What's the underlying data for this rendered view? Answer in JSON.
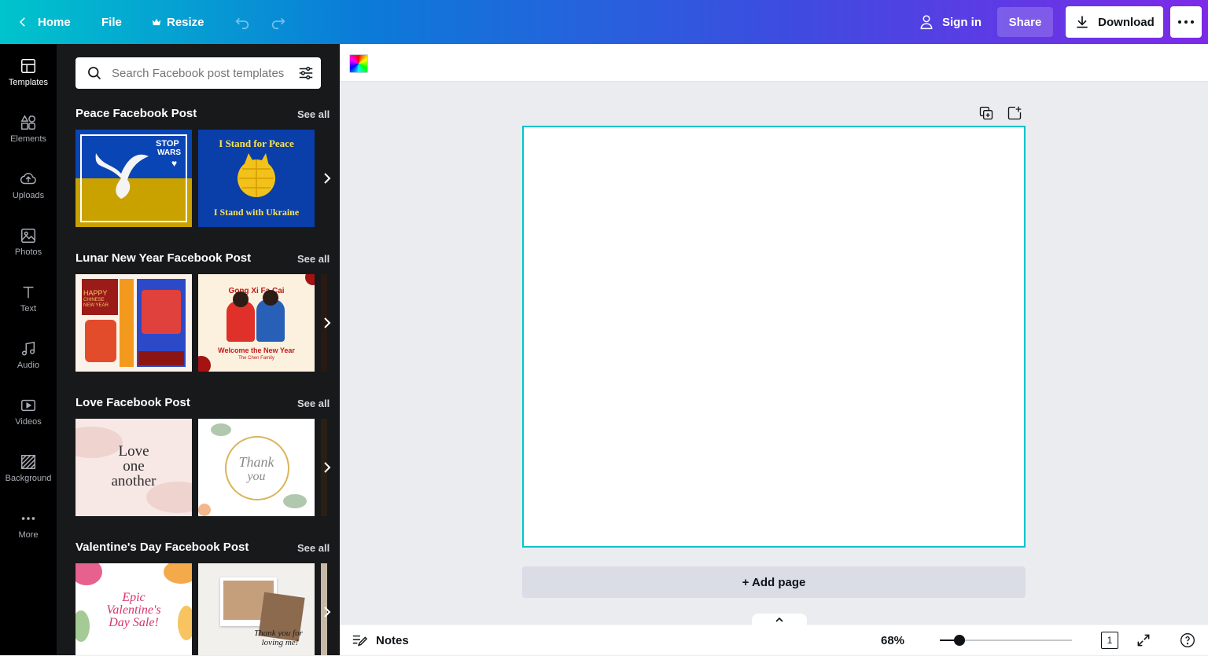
{
  "topbar": {
    "home_label": "Home",
    "file_label": "File",
    "resize_label": "Resize",
    "sign_in_label": "Sign in",
    "share_label": "Share",
    "download_label": "Download"
  },
  "rail": {
    "items": [
      {
        "label": "Templates",
        "icon": "templates-icon",
        "active": true
      },
      {
        "label": "Elements",
        "icon": "elements-icon"
      },
      {
        "label": "Uploads",
        "icon": "upload-cloud-icon"
      },
      {
        "label": "Photos",
        "icon": "image-icon"
      },
      {
        "label": "Text",
        "icon": "text-icon"
      },
      {
        "label": "Audio",
        "icon": "music-note-icon"
      },
      {
        "label": "Videos",
        "icon": "video-icon"
      },
      {
        "label": "Background",
        "icon": "background-pattern-icon"
      },
      {
        "label": "More",
        "icon": "more-dots-icon"
      }
    ]
  },
  "panel": {
    "search_placeholder": "Search Facebook post templates",
    "sections": [
      {
        "title": "Peace Facebook Post",
        "see_all": "See all",
        "thumbs": [
          {
            "text1": "STOP",
            "text2": "WARS"
          },
          {
            "text1": "I Stand for Peace",
            "text2": "I Stand with Ukraine"
          }
        ]
      },
      {
        "title": "Lunar New Year Facebook Post",
        "see_all": "See all",
        "thumbs": [
          {
            "text1": "HAPPY",
            "text2": "CHINESE NEW YEAR"
          },
          {
            "text1": "Gong Xi Fa Cai",
            "text2": "Welcome the New Year",
            "text3": "The Chen Family"
          }
        ]
      },
      {
        "title": "Love Facebook Post",
        "see_all": "See all",
        "thumbs": [
          {
            "text1": "Love",
            "text2": "one",
            "text3": "another"
          },
          {
            "text1": "Thank",
            "text2": "you"
          }
        ]
      },
      {
        "title": "Valentine's Day Facebook Post",
        "see_all": "See all",
        "thumbs": [
          {
            "text1": "Epic",
            "text2": "Valentine's",
            "text3": "Day Sale!"
          },
          {
            "text1": "Thank you for",
            "text2": "loving me!"
          }
        ]
      }
    ]
  },
  "canvas": {
    "add_page_label": "+ Add page"
  },
  "bottombar": {
    "notes_label": "Notes",
    "zoom_label": "68%",
    "zoom_value": 0.12,
    "page_count": "1"
  },
  "colors": {
    "accent": "#00c4cc",
    "gradient_start": "#00c4cc",
    "gradient_end": "#7d2ae8"
  }
}
